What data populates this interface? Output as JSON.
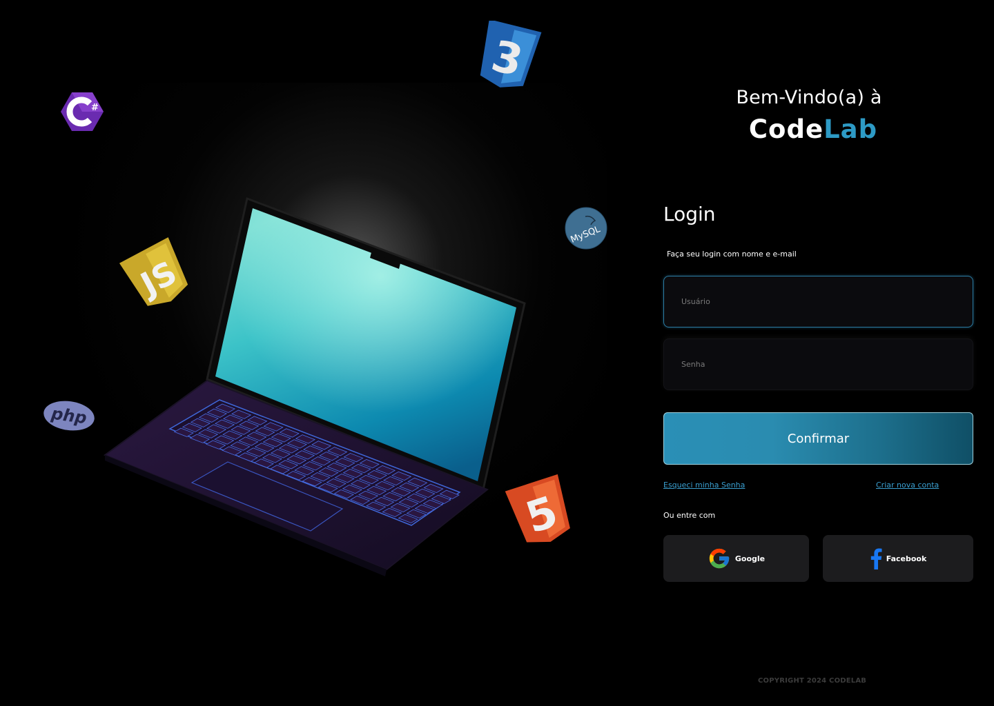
{
  "welcome": {
    "line1": "Bem-Vindo(a) à",
    "brand_part1": "Code",
    "brand_part2": "Lab"
  },
  "login": {
    "title": "Login",
    "subtitle": "Faça seu login com nome e e-mail",
    "username_placeholder": "Usuário",
    "password_placeholder": "Senha",
    "confirm_label": "Confirmar",
    "forgot_label": "Esqueci minha Senha",
    "create_label": "Criar nova conta",
    "or_label": "Ou entre com"
  },
  "social": {
    "google_label": "Google",
    "facebook_label": "Facebook"
  },
  "footer": {
    "copyright": "COPYRIGHT 2024 CODELAB"
  },
  "illustration": {
    "badges": [
      "csharp-icon",
      "css3-icon",
      "javascript-icon",
      "mysql-icon",
      "php-icon",
      "html5-icon"
    ],
    "logo_text": {
      "csharp": "#",
      "mysql": "MySQL",
      "php": "php",
      "css": "3",
      "js": "JS",
      "html": "5"
    }
  },
  "colors": {
    "accent": "#2d9ac5",
    "background": "#000000",
    "field": "#0b0b0e",
    "social": "#1c1c1e"
  }
}
